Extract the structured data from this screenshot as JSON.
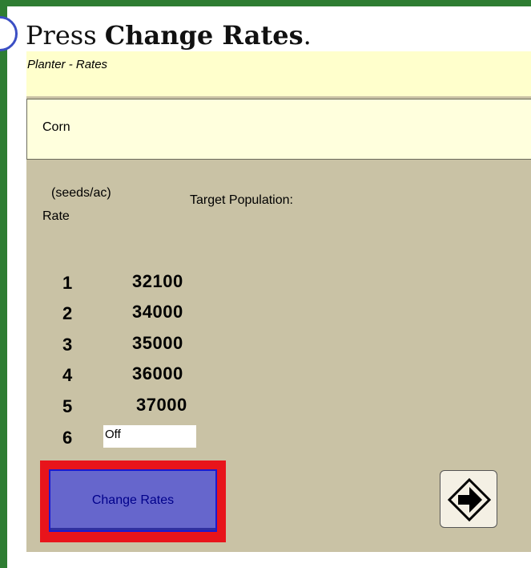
{
  "instruction": {
    "prefix": "Press ",
    "bold": "Change Rates",
    "suffix": "."
  },
  "screen": {
    "title": "Planter - Rates",
    "crop": "Corn",
    "units_label": "(seeds/ac)",
    "target_label": "Target Population:",
    "rate_header": "Rate",
    "rates": [
      {
        "num": "1",
        "value": "32100"
      },
      {
        "num": "2",
        "value": "34000"
      },
      {
        "num": "3",
        "value": "35000"
      },
      {
        "num": "4",
        "value": "36000"
      },
      {
        "num": "5",
        "value": "37000"
      },
      {
        "num": "6",
        "value": "Off"
      }
    ],
    "change_rates_button": "Change Rates"
  },
  "icons": {
    "step_badge": "step-number-badge",
    "next": "arrow-right-icon"
  },
  "colors": {
    "frame": "#2e7d32",
    "highlight": "#e8141b",
    "button": "#6666cc",
    "screen_bg": "#c9c2a5"
  }
}
